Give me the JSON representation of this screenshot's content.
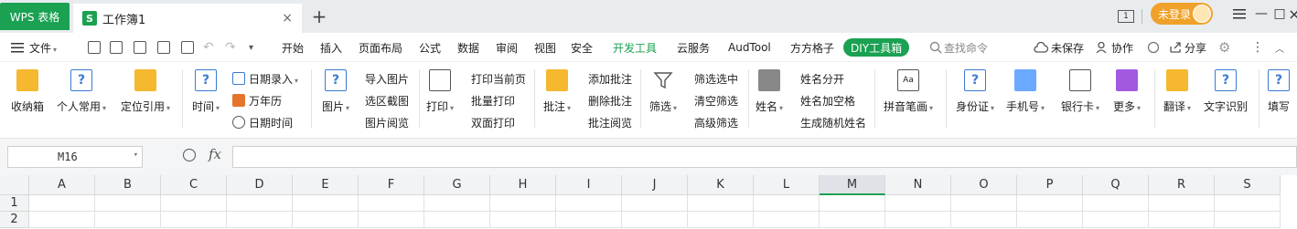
{
  "titlebar": {
    "wps_tab": "WPS 表格",
    "book_icon": "S",
    "book_title": "工作簿1",
    "close_glyph": "×",
    "add_glyph": "+",
    "page_num": "1",
    "login_label": "未登录",
    "win_min": "—",
    "win_max": "□",
    "win_close": "×",
    "accent": "#1aa152",
    "login_color": "#f0a12a"
  },
  "menubar": {
    "menu_label": "文件",
    "tabs": [
      "开始",
      "插入",
      "页面布局",
      "公式",
      "数据",
      "审阅",
      "视图",
      "安全",
      "开发工具",
      "云服务",
      "AudTool",
      "方方格子",
      "DIY工具箱"
    ],
    "search": "查找命令",
    "unsaved": "未保存",
    "collab": "协作",
    "share": "分享"
  },
  "ribbon": {
    "inbox": "收纳箱",
    "personal": "个人常用",
    "locate_ref": "定位引用",
    "time": "时间",
    "date_entry": "日期录入",
    "perpetual_cal": "万年历",
    "date_time": "日期时间",
    "image": "图片",
    "import_image": "导入图片",
    "region_screenshot": "选区截图",
    "image_view": "图片阅览",
    "print": "打印",
    "print_current": "打印当前页",
    "batch_print": "批量打印",
    "duplex_print": "双面打印",
    "comment": "批注",
    "add_comment": "添加批注",
    "delete_comment": "删除批注",
    "view_comment": "批注阅览",
    "filter": "筛选",
    "filter_selected": "筛选选中",
    "clear_filter": "清空筛选",
    "advanced_filter": "高级筛选",
    "name": "姓名",
    "split_name": "姓名分开",
    "name_space": "姓名加空格",
    "random_name": "生成随机姓名",
    "pinyin": "拼音笔画",
    "id_card": "身份证",
    "phone": "手机号",
    "bank_card": "银行卡",
    "more": "更多",
    "translate": "翻译",
    "ocr": "文字识别",
    "fill": "填写"
  },
  "formula": {
    "name_box": "M16",
    "fx": "fx"
  },
  "grid": {
    "columns": [
      "A",
      "B",
      "C",
      "D",
      "E",
      "F",
      "G",
      "H",
      "I",
      "J",
      "K",
      "L",
      "M",
      "N",
      "O",
      "P",
      "Q",
      "R",
      "S"
    ],
    "rows": [
      "1",
      "2"
    ],
    "selected_column": "M"
  }
}
